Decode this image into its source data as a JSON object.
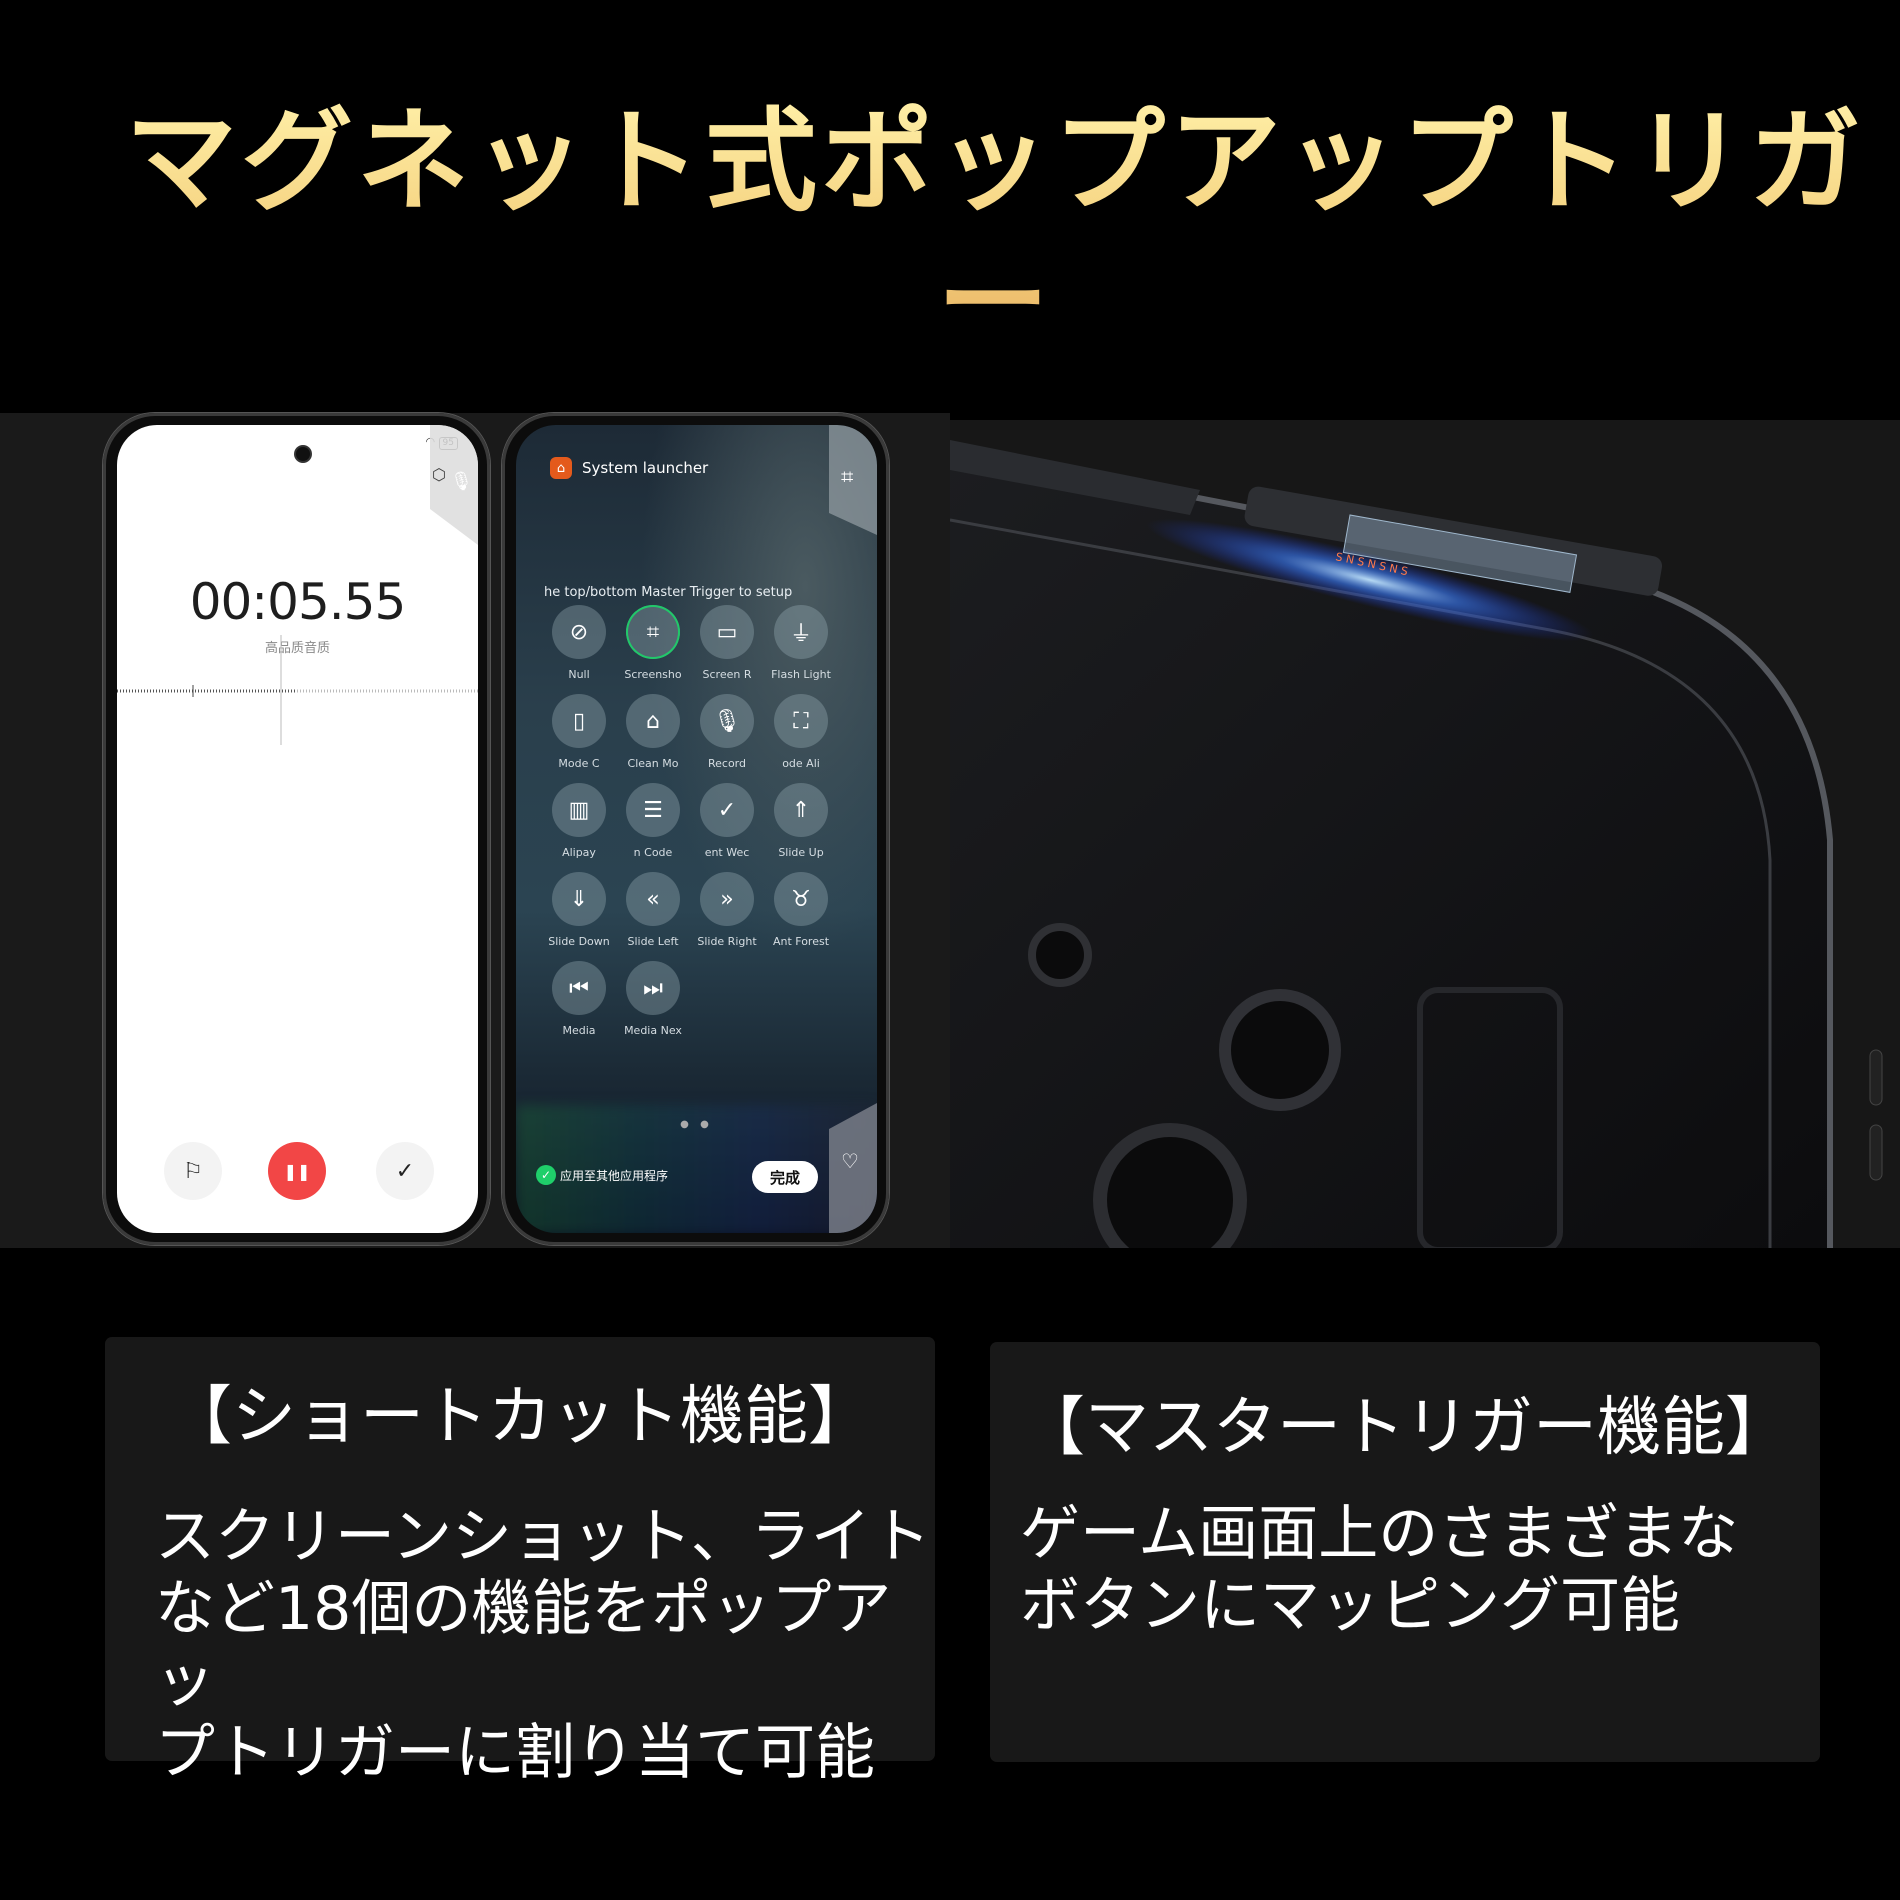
{
  "title": "マグネット式ポップアップトリガー",
  "colors": {
    "title_gradient_top": "#fff0a8",
    "title_gradient_bottom": "#e6ad5c",
    "record_button": "#f24646",
    "selected_ring": "#21c86a",
    "launcher_icon": "#e45a1c",
    "card_bg": "#181818"
  },
  "recorder": {
    "status": {
      "wifi_icon": "wifi-icon",
      "battery": "95"
    },
    "side_icons": [
      "settings-icon",
      "microphone-icon"
    ],
    "timer": "00:05.55",
    "quality": "高品质音质",
    "controls": [
      {
        "name": "flag",
        "icon": "⚐"
      },
      {
        "name": "pause",
        "icon": "❚❚"
      },
      {
        "name": "done",
        "icon": "✓"
      }
    ]
  },
  "launcher": {
    "header": "System launcher",
    "side_tab_icon": "crop-icon",
    "hint": "he top/bottom Master Trigger to setup",
    "items": [
      {
        "label": "Null",
        "icon": "⊘",
        "selected": false
      },
      {
        "label": "Screensho",
        "icon": "⌗",
        "selected": true
      },
      {
        "label": "Screen R",
        "icon": "▭",
        "selected": false
      },
      {
        "label": "Flash Light",
        "icon": "⏚",
        "selected": false
      },
      {
        "label": "Mode     C",
        "icon": "▯",
        "selected": false
      },
      {
        "label": "Clean Mo",
        "icon": "⌂",
        "selected": false
      },
      {
        "label": "Record",
        "icon": "🎙",
        "selected": false
      },
      {
        "label": "ode    Ali",
        "icon": "⛶",
        "selected": false
      },
      {
        "label": "Alipay",
        "icon": "▥",
        "selected": false
      },
      {
        "label": "n Code",
        "icon": "☰",
        "selected": false
      },
      {
        "label": "ent   Wec",
        "icon": "✓",
        "selected": false
      },
      {
        "label": "Slide Up",
        "icon": "⇑",
        "selected": false
      },
      {
        "label": "Slide Down",
        "icon": "⇓",
        "selected": false
      },
      {
        "label": "Slide Left",
        "icon": "«",
        "selected": false
      },
      {
        "label": "Slide Right",
        "icon": "»",
        "selected": false
      },
      {
        "label": "Ant Forest",
        "icon": "♉",
        "selected": false
      },
      {
        "label": "Media",
        "icon": "⏮",
        "selected": false
      },
      {
        "label": "Media Nex",
        "icon": "⏭",
        "selected": false
      }
    ],
    "page_dots": "● ●",
    "apply_label": "应用至其他应用程序",
    "done_label": "完成",
    "bottom_tab_icon": "face-heart-icon"
  },
  "cards": [
    {
      "title": "【ショートカット機能】",
      "body": [
        "スクリーンショット、ライト",
        "など18個の機能をポップアッ",
        "プトリガーに割り当て可能"
      ]
    },
    {
      "title": "【マスタートリガー機能】",
      "body": [
        "ゲーム画面上のさまざまな",
        "ボタンにマッピング可能"
      ]
    }
  ]
}
